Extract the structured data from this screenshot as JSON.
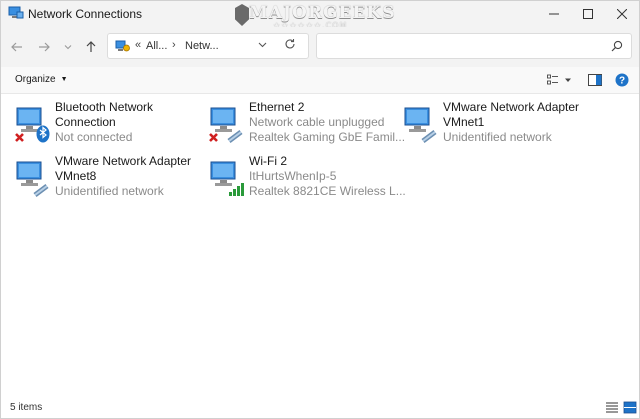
{
  "window": {
    "title": "Network Connections",
    "watermark": "MAJORGEEKS",
    "watermark_sub": "★★★★★★.COM"
  },
  "navigation": {
    "crumb_overflow": "«",
    "breadcrumbs": [
      "All...",
      "Netw..."
    ],
    "search_placeholder": ""
  },
  "toolbar": {
    "organize_label": "Organize"
  },
  "connections": [
    {
      "name": "Bluetooth Network Connection",
      "line1": "Bluetooth Network",
      "line2": "Connection",
      "status": "Not connected",
      "detail": "",
      "kind": "bluetooth",
      "state": "disconnected"
    },
    {
      "name": "Ethernet 2",
      "line1": "Ethernet 2",
      "line2": "",
      "status": "Network cable unplugged",
      "detail": "Realtek Gaming GbE Famil...",
      "kind": "ethernet",
      "state": "disconnected"
    },
    {
      "name": "VMware Network Adapter VMnet1",
      "line1": "VMware Network Adapter",
      "line2": "VMnet1",
      "status": "Unidentified network",
      "detail": "",
      "kind": "ethernet",
      "state": "connected"
    },
    {
      "name": "VMware Network Adapter VMnet8",
      "line1": "VMware Network Adapter",
      "line2": "VMnet8",
      "status": "Unidentified network",
      "detail": "",
      "kind": "ethernet",
      "state": "connected"
    },
    {
      "name": "Wi-Fi 2",
      "line1": "Wi-Fi 2",
      "line2": "",
      "status": "ItHurtsWhenIp-5",
      "detail": "Realtek 8821CE Wireless L...",
      "kind": "wifi",
      "state": "connected"
    }
  ],
  "status_bar": {
    "item_count": "5 items"
  },
  "colors": {
    "accent_blue": "#1e73c8",
    "error_red": "#d02020",
    "signal_green": "#2a9a3a",
    "muted_text": "#8a8a8a"
  }
}
